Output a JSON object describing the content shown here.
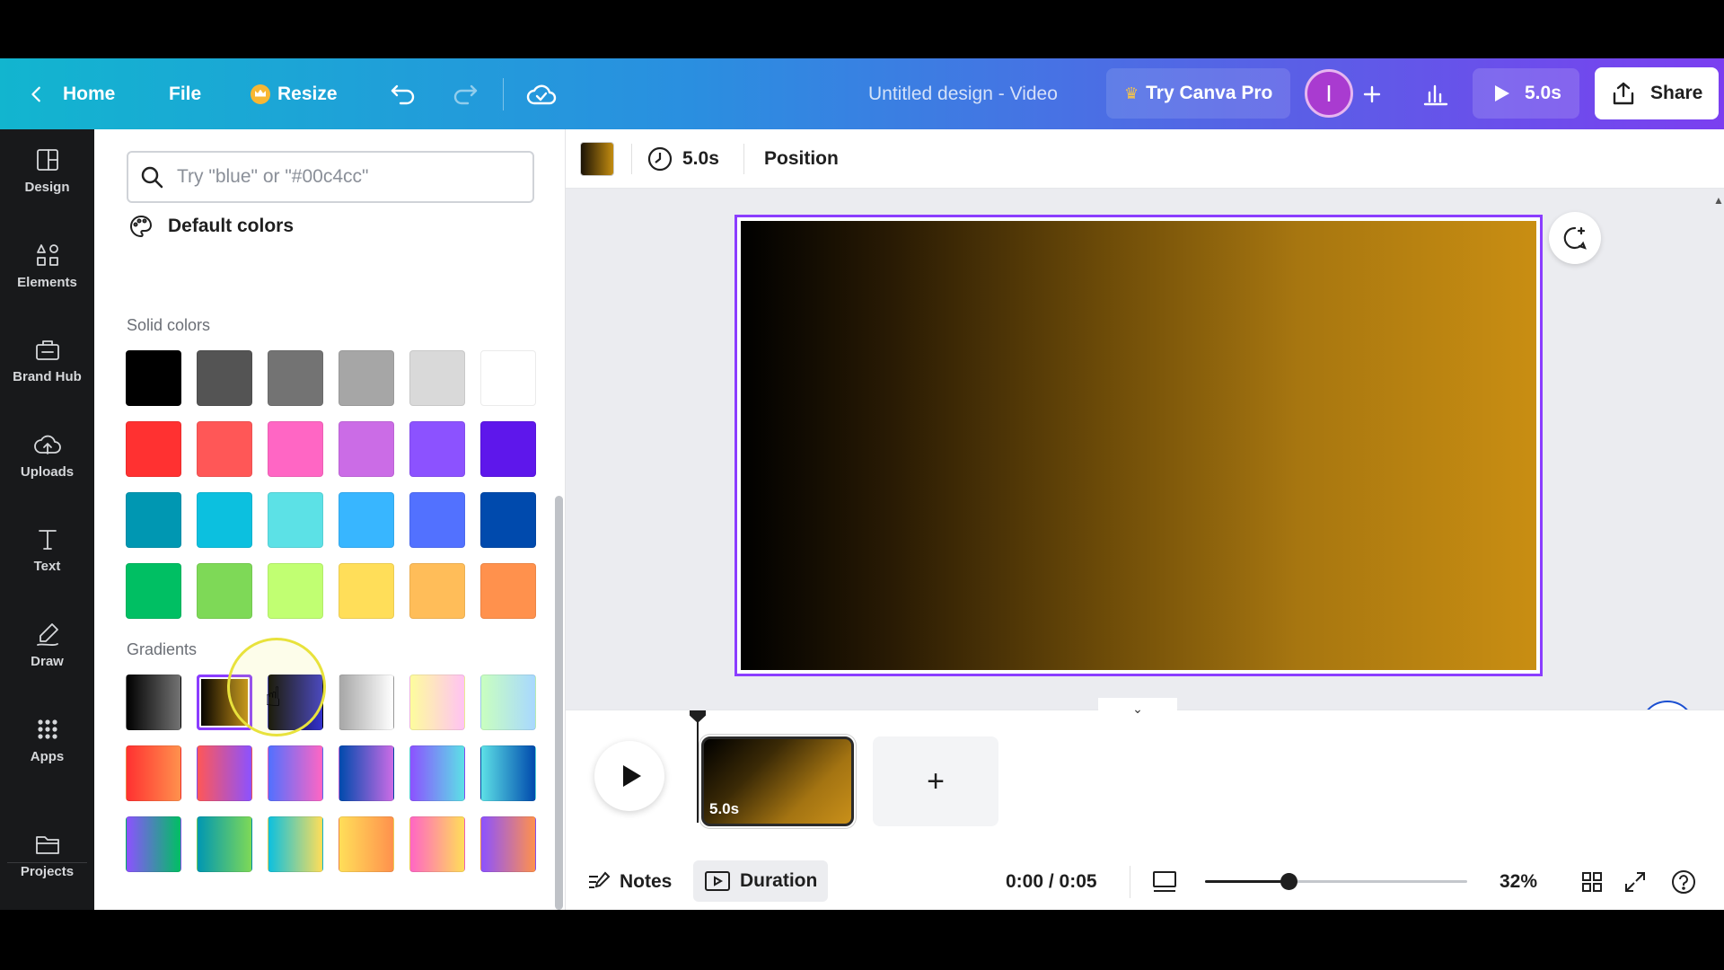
{
  "topbar": {
    "home": "Home",
    "file": "File",
    "resize": "Resize",
    "title": "Untitled design - Video",
    "try_pro": "Try Canva Pro",
    "avatar_initial": "I",
    "play_duration": "5.0s",
    "share": "Share"
  },
  "rail": {
    "design": "Design",
    "elements": "Elements",
    "brand_hub": "Brand Hub",
    "uploads": "Uploads",
    "text": "Text",
    "draw": "Draw",
    "apps": "Apps",
    "projects": "Projects"
  },
  "panel": {
    "search_placeholder": "Try \"blue\" or \"#00c4cc\"",
    "default_colors": "Default colors",
    "solid_label": "Solid colors",
    "gradients_label": "Gradients",
    "solid_colors": [
      "#000000",
      "#545454",
      "#737373",
      "#a6a6a6",
      "#d9d9d9",
      "#ffffff",
      "#ff3131",
      "#ff5757",
      "#ff66c4",
      "#cb6ce6",
      "#8c52ff",
      "#5e17eb",
      "#0097b2",
      "#0cc0df",
      "#5ce1e6",
      "#38b6ff",
      "#5271ff",
      "#004aad",
      "#00bf63",
      "#7ed957",
      "#c1ff72",
      "#ffde59",
      "#ffbd59",
      "#ff914d"
    ],
    "gradients": [
      "linear-gradient(90deg, #000000, #737373)",
      "linear-gradient(90deg, #000000, #c89116)",
      "linear-gradient(90deg, #000000, #3533cd)",
      "linear-gradient(90deg, #a6a6a6, #ffffff)",
      "linear-gradient(90deg, #fdfc9d, #ffc3f3)",
      "linear-gradient(90deg, #c9ffbf, #a8d8ff)",
      "linear-gradient(90deg, #ff3131, #ff914d)",
      "linear-gradient(90deg, #ff5757, #8c52ff)",
      "linear-gradient(90deg, #5170ff, #ff66c4)",
      "linear-gradient(90deg, #004aad, #cb6ce6)",
      "linear-gradient(90deg, #8c52ff, #5ce1e6)",
      "linear-gradient(90deg, #5de0e6, #004aad)",
      "linear-gradient(90deg, #8c52ff, #00bf63)",
      "linear-gradient(90deg, #0097b2, #7ed957)",
      "linear-gradient(90deg, #0cc0df, #ffde59)",
      "linear-gradient(90deg, #ffde59, #ff914d)",
      "linear-gradient(90deg, #ff66c4, #ffde59)",
      "linear-gradient(90deg, #8c52ff, #ff914d)"
    ],
    "selected_gradient_index": 1
  },
  "toolbar": {
    "duration": "5.0s",
    "position": "Position",
    "selected_color": "linear-gradient(90deg, #1a1205, #c38c10)"
  },
  "timeline": {
    "clip_duration": "5.0s",
    "add_page": "+"
  },
  "footer": {
    "notes": "Notes",
    "duration": "Duration",
    "time": "0:00 / 0:05",
    "zoom": "32%",
    "zoom_fraction": 0.32
  },
  "colors": {
    "accent": "#8b3dff",
    "magic_blue": "#1b4fd1"
  }
}
